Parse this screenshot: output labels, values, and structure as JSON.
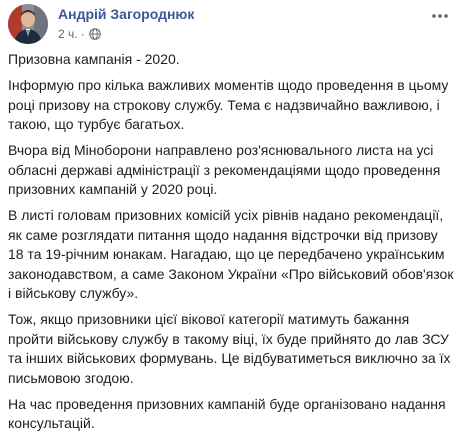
{
  "post": {
    "author_name": "Андрій Загороднюк",
    "timestamp": "2 ч.",
    "separator": "·",
    "privacy_icon": "globe-icon",
    "more_icon": "more-options-icon",
    "title": "Призовна кампанія - 2020.",
    "paragraphs": [
      "Інформую про кілька важливих моментів щодо проведення в цьому році призову на строкову службу. Тема є надзвичайно важливою, і такою, що турбує багатьох.",
      "Вчора від Міноборони направлено роз'яснювального листа на усі обласні державі адміністрації з рекомендаціями щодо проведення призовних кампаній у 2020 році.",
      "В листі головам призовних комісій усіх рівнів надано рекомендації, як саме розглядати питання щодо надання відстрочки від призову 18 та 19-річним юнакам. Нагадаю, що це передбачено українським законодавством, а саме Законом України «Про військовий обов'язок і військову службу».",
      "Тож, якщо призовники цієї вікової категорії матимуть бажання пройти військову службу в такому віці, їх буде прийнято до лав ЗСУ та інших військових формувань. Це відбуватиметься виключно за їх письмовою згодою.",
      "На час проведення призовних кампаній буде організовано надання консультацій."
    ]
  },
  "colors": {
    "author_link": "#385898",
    "meta_text": "#616770",
    "body_text": "#1c1e21"
  }
}
